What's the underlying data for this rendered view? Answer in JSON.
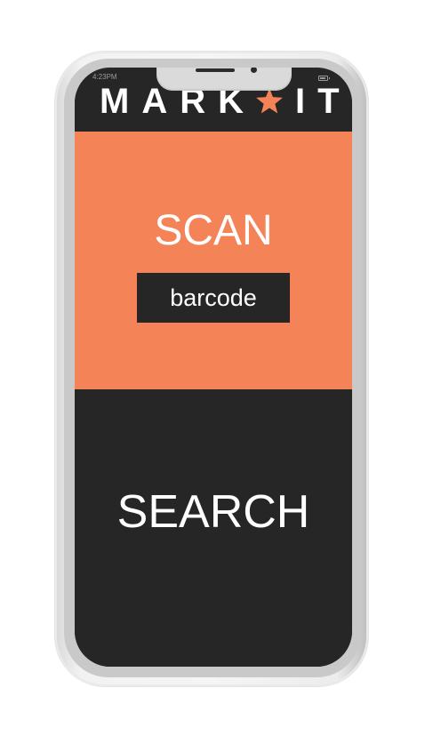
{
  "status_bar": {
    "time": "4:23PM",
    "battery_icon": "battery-icon"
  },
  "header": {
    "logo_left": "MARK",
    "logo_star_icon": "star-icon",
    "logo_right": "IT",
    "accent_color": "#f48358"
  },
  "scan": {
    "title": "SCAN",
    "button_label": "barcode",
    "background": "#f48358"
  },
  "search": {
    "title": "SEARCH",
    "background": "#262626"
  }
}
